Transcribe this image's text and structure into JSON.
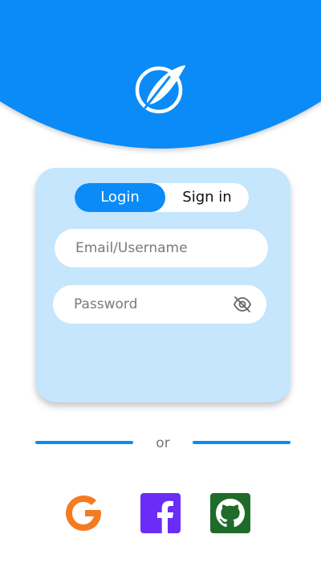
{
  "theme": {
    "primary": "#0a8bf7",
    "card_bg": "#c5e6fc",
    "google_orange": "#f47b20",
    "facebook_purple": "#6c2cf7",
    "github_green": "#1f6b2a"
  },
  "header": {
    "logo_icon": "feather-in-circle-icon"
  },
  "auth_tabs": {
    "active": "login",
    "login_label": "Login",
    "signin_label": "Sign in"
  },
  "form": {
    "email_placeholder": "Email/Username",
    "email_value": "",
    "password_placeholder": "Password",
    "password_value": "",
    "password_toggle_icon": "eye-off-icon"
  },
  "divider": {
    "label": "or"
  },
  "social_login": [
    {
      "provider": "google",
      "icon": "google-icon"
    },
    {
      "provider": "facebook",
      "icon": "facebook-icon"
    },
    {
      "provider": "github",
      "icon": "github-icon"
    }
  ]
}
